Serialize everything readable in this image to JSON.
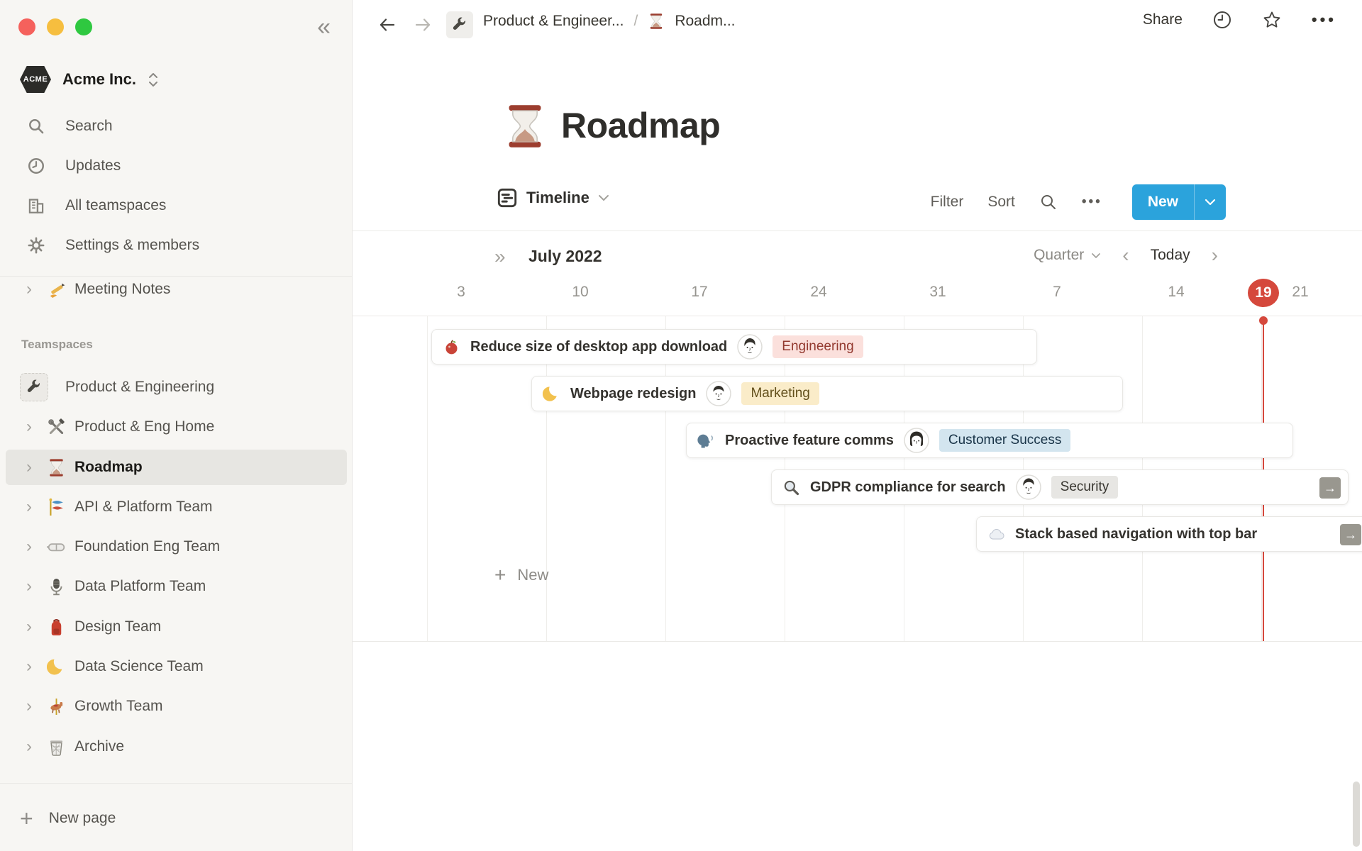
{
  "window": {
    "traffic_lights": [
      "#F5615C",
      "#F6BE3F",
      "#2FC840"
    ]
  },
  "sidebar": {
    "workspace": {
      "name": "Acme Inc.",
      "logo_text": "ACME"
    },
    "menu": [
      {
        "icon": "search-icon",
        "label": "Search"
      },
      {
        "icon": "clock-icon",
        "label": "Updates"
      },
      {
        "icon": "building-icon",
        "label": "All teamspaces"
      },
      {
        "icon": "gear-icon",
        "label": "Settings & members"
      }
    ],
    "shared_pages": [
      {
        "icon": "writing-hand-icon",
        "label": "Meeting Notes"
      }
    ],
    "teamspaces_label": "Teamspaces",
    "teamspaces": [
      {
        "icon": "wrench-icon",
        "label": "Product & Engineering"
      },
      {
        "icon": "hammer-wrench-icon",
        "label": "Product & Eng Home"
      },
      {
        "icon": "hourglass-icon",
        "label": "Roadmap",
        "selected": true
      },
      {
        "icon": "carp-streamer-icon",
        "label": "API & Platform Team"
      },
      {
        "icon": "goggles-icon",
        "label": "Foundation Eng Team"
      },
      {
        "icon": "microphone-icon",
        "label": "Data Platform Team"
      },
      {
        "icon": "backpack-icon",
        "label": "Design Team"
      },
      {
        "icon": "crescent-moon-icon",
        "label": "Data Science Team"
      },
      {
        "icon": "carousel-horse-icon",
        "label": "Growth Team"
      },
      {
        "icon": "wastebasket-icon",
        "label": "Archive"
      }
    ],
    "new_page_label": "New page"
  },
  "topbar": {
    "breadcrumb": {
      "teamspace": "Product & Engineer...",
      "separator": "/",
      "page": "Roadm...",
      "page_icon": "hourglass-icon"
    },
    "share_label": "Share"
  },
  "page": {
    "icon": "hourglass-icon",
    "title": "Roadmap"
  },
  "view_toolbar": {
    "view_label": "Timeline",
    "filter_label": "Filter",
    "sort_label": "Sort",
    "new_label": "New"
  },
  "timeline": {
    "month_label": "July 2022",
    "zoom_level": "Quarter",
    "today_label": "Today",
    "dates": [
      "3",
      "10",
      "17",
      "24",
      "31",
      "7",
      "14",
      "19",
      "21"
    ],
    "today_date": "19",
    "new_row_label": "New",
    "items": [
      {
        "icon": "apple-icon",
        "title": "Reduce size of desktop app download",
        "assignee": "man-sketch-avatar",
        "tag": "Engineering",
        "tag_color": "red"
      },
      {
        "icon": "crescent-moon-icon",
        "title": "Webpage redesign",
        "assignee": "man-sketch-avatar",
        "tag": "Marketing",
        "tag_color": "yellow"
      },
      {
        "icon": "speaking-head-icon",
        "title": "Proactive feature comms",
        "assignee": "woman-sketch-avatar",
        "tag": "Customer Success",
        "tag_color": "blue"
      },
      {
        "icon": "magnifier-icon",
        "title": "GDPR compliance for search",
        "assignee": "man-sketch-avatar",
        "tag": "Security",
        "tag_color": "gray",
        "has_open_arrow": true
      },
      {
        "icon": "cloud-icon",
        "title": "Stack based navigation with top bar",
        "assignee": null,
        "tag": null,
        "has_open_arrow": true
      }
    ]
  },
  "colors": {
    "accent_blue": "#2BA3DC",
    "today_red": "#D5483C",
    "sidebar_bg": "#F7F6F3",
    "tag_red_bg": "#FBE0DC",
    "tag_red_text": "#93392F",
    "tag_yellow_bg": "#FAECC9",
    "tag_yellow_text": "#63501C",
    "tag_blue_bg": "#D3E5EF",
    "tag_blue_text": "#183347",
    "tag_gray_bg": "#E7E6E3",
    "tag_gray_text": "#37352F"
  }
}
